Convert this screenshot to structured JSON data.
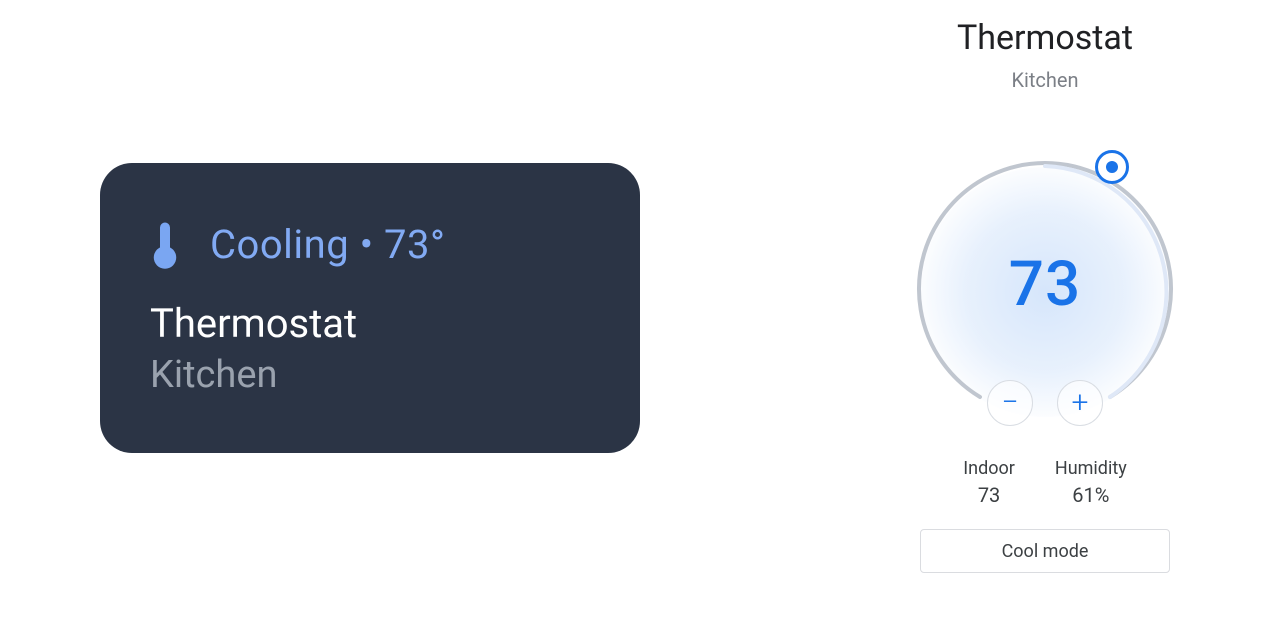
{
  "card": {
    "status": "Cooling",
    "separator": " • ",
    "setpoint_display": "73°",
    "device_name": "Thermostat",
    "room": "Kitchen"
  },
  "detail": {
    "title": "Thermostat",
    "room": "Kitchen",
    "setpoint": "73",
    "decrease_glyph": "−",
    "increase_glyph": "+",
    "indoor_label": "Indoor",
    "indoor_value": "73",
    "humidity_label": "Humidity",
    "humidity_value": "61%",
    "mode_label": "Cool mode"
  },
  "colors": {
    "accent": "#1a73e8",
    "accent_light": "#7aa6f2",
    "card_bg": "#2b3445",
    "muted": "#9aa2ae"
  }
}
